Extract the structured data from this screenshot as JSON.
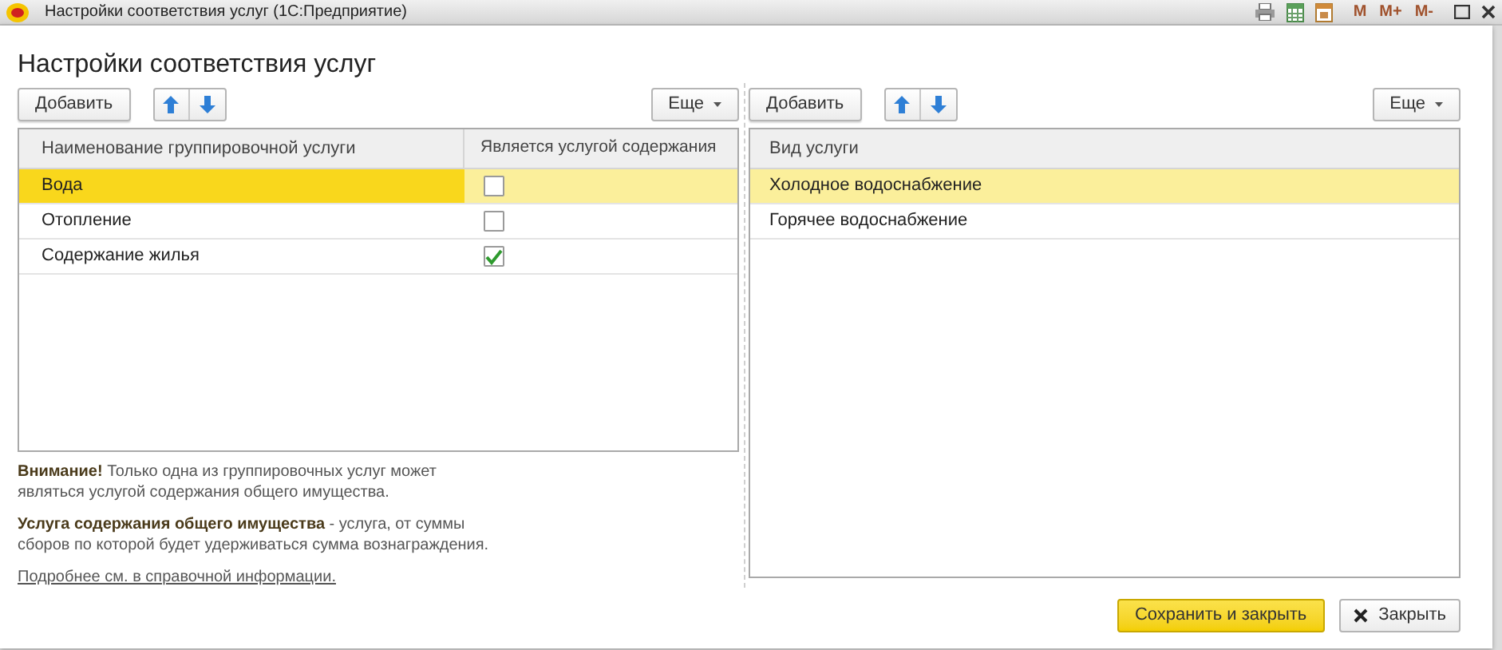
{
  "window": {
    "title": "Настройки соответствия услуг  (1С:Предприятие)",
    "memory_buttons": [
      "M",
      "M+",
      "M-"
    ]
  },
  "heading": "Настройки соответствия услуг",
  "left_panel": {
    "add_button": "Добавить",
    "more_button": "Еще",
    "columns": [
      "Наименование группировочной услуги",
      "Является услугой содержания"
    ],
    "rows": [
      {
        "name": "Вода",
        "checked": false,
        "selected": true
      },
      {
        "name": "Отопление",
        "checked": false,
        "selected": false
      },
      {
        "name": "Содержание жилья",
        "checked": true,
        "selected": false
      }
    ]
  },
  "notes": [
    "**Внимание!** Только одна из группировочных услуг может являться услугой содержания общего имущества.",
    "**Услуга содержания общего имущества** - услуга, от суммы сборов по которой будет удерживаться сумма вознаграждения."
  ],
  "help_link": "Подробнее см. в справочной информации.",
  "right_panel": {
    "add_button": "Добавить",
    "more_button": "Еще",
    "columns": [
      "Вид услуги"
    ],
    "rows": [
      {
        "name": "Холодное водоснабжение",
        "selected": true
      },
      {
        "name": "Горячее водоснабжение",
        "selected": false
      }
    ]
  },
  "footer": {
    "save_button": "Сохранить и закрыть",
    "close_button": "Закрыть"
  }
}
